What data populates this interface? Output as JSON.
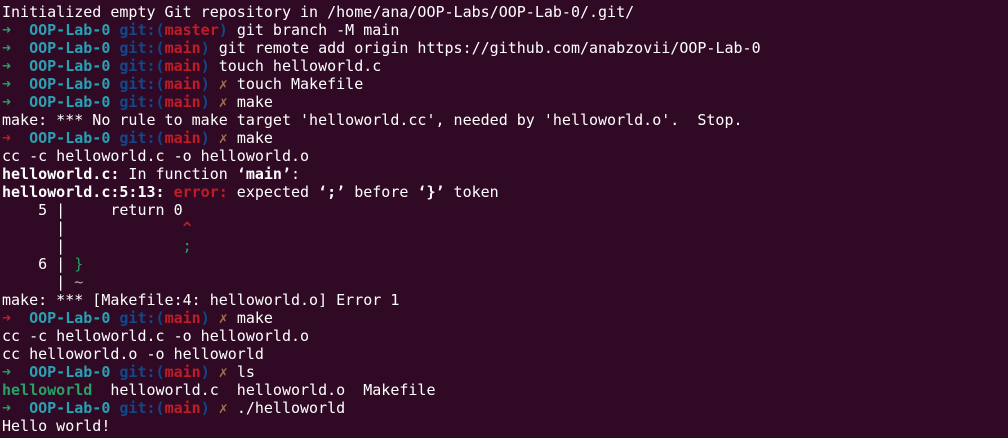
{
  "colors": {
    "background": "#300a24",
    "prompt_arrow_ok": "#26a269",
    "prompt_arrow_err": "#c01c28",
    "dir": "#2aa1b3",
    "git_label": "#12488b",
    "branch": "#c01c28",
    "dirty_mark": "#a2734c",
    "text": "#ffffff"
  },
  "prompt": {
    "arrow": "➜",
    "dir": "OOP-Lab-0",
    "git_open": "git:(",
    "git_close": ")",
    "dirty": "✗"
  },
  "lines": {
    "l1": "Initialized empty Git repository in /home/ana/OOP-Labs/OOP-Lab-0/.git/",
    "l2_branch": "master",
    "l2_cmd": "git branch -M main",
    "l3_branch": "main",
    "l3_cmd": "git remote add origin https://github.com/anabzovii/OOP-Lab-0",
    "l4_branch": "main",
    "l4_cmd": "touch helloworld.c",
    "l5_branch": "main",
    "l5_cmd": "touch Makefile",
    "l6_branch": "main",
    "l6_cmd": "make",
    "l7": "make: *** No rule to make target 'helloworld.cc', needed by 'helloworld.o'.  Stop.",
    "l8_branch": "main",
    "l8_cmd": "make",
    "l9": "cc -c helloworld.c -o helloworld.o",
    "l10_file": "helloworld.c:",
    "l10_text": " In function ",
    "l10_fn": "‘main’",
    "l10_end": ":",
    "l11_loc": "helloworld.c:5:13:",
    "l11_err": " error:",
    "l11_text": " expected ",
    "l11_q1": "‘;’",
    "l11_mid": " before ",
    "l11_q2": "‘}’",
    "l11_end": " token",
    "l12_num": "    5 |",
    "l12_code": "     return 0",
    "l13_gutter": "      |",
    "l13_caret": "             ^",
    "l14_gutter": "      |",
    "l14_fix": "             ;",
    "l15_num": "    6 |",
    "l15_code": " }",
    "l16_gutter": "      |",
    "l16_tilde": " ~",
    "l17": "make: *** [Makefile:4: helloworld.o] Error 1",
    "l18_branch": "main",
    "l18_cmd": "make",
    "l19": "cc -c helloworld.c -o helloworld.o",
    "l20": "cc helloworld.o -o helloworld",
    "l21_branch": "main",
    "l21_cmd": "ls",
    "l22_exec": "helloworld",
    "l22_rest": "  helloworld.c  helloworld.o  Makefile",
    "l23_branch": "main",
    "l23_cmd": "./helloworld",
    "l24": "Hello world!"
  }
}
